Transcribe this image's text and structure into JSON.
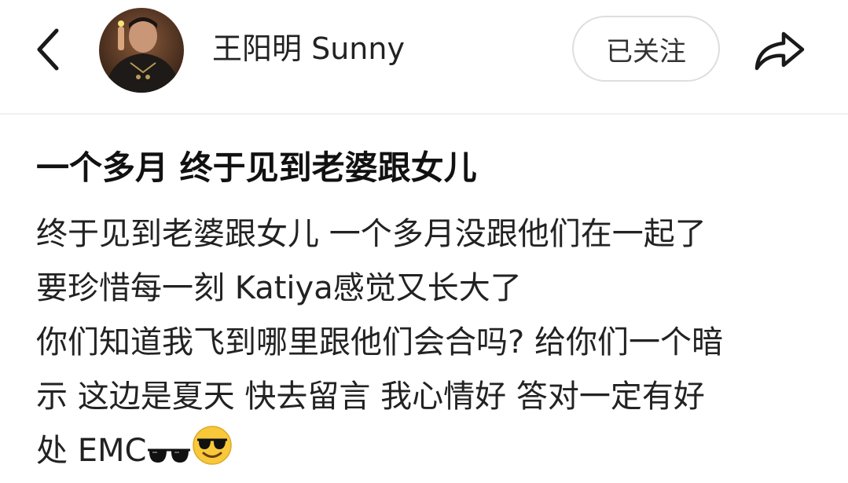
{
  "header": {
    "back_icon": "chevron-left-icon",
    "username": "王阳明 Sunny",
    "follow_label": "已关注",
    "share_icon": "share-arrow-icon"
  },
  "post": {
    "title": "一个多月 终于见到老婆跟女儿",
    "body_lines": [
      "终于见到老婆跟女儿 一个多月没跟他们在一起了",
      "要珍惜每一刻 Katiya感觉又长大了",
      "你们知道我飞到哪里跟他们会合吗? 给你们一个暗",
      "示 这边是夏天 快去留言 我心情好 答对一定有好",
      "处 EMC"
    ],
    "trailing_emojis": [
      "sunglasses-icon",
      "smiling-face-with-sunglasses-icon"
    ]
  },
  "colors": {
    "background": "#ffffff",
    "text": "#1a1a1a",
    "follow_border": "#dedede",
    "divider": "#f0f0f0"
  }
}
